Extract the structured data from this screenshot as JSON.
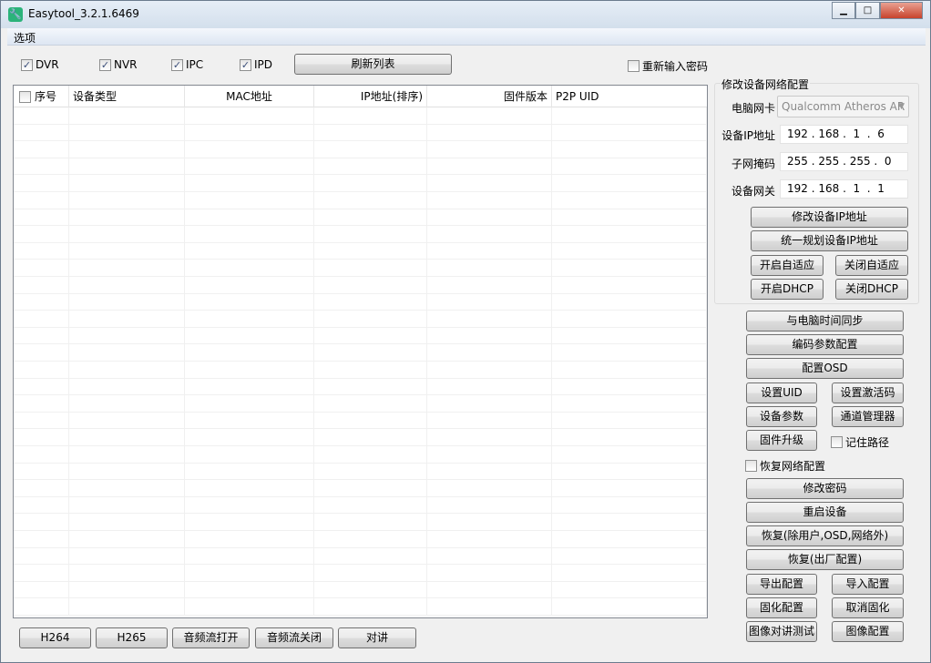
{
  "window": {
    "title": "Easytool_3.2.1.6469",
    "min": "▁",
    "max": "□",
    "close": "✕"
  },
  "menu": {
    "options": "选项"
  },
  "filters": [
    {
      "label": "DVR",
      "checked": true
    },
    {
      "label": "NVR",
      "checked": true
    },
    {
      "label": "IPC",
      "checked": true
    },
    {
      "label": "IPD",
      "checked": true
    }
  ],
  "refresh": "刷新列表",
  "reenter_password": {
    "label": "重新输入密码",
    "checked": false
  },
  "table": {
    "columns": [
      "序号",
      "设备类型",
      "MAC地址",
      "IP地址(排序)",
      "固件版本",
      "P2P UID"
    ],
    "rows": []
  },
  "network": {
    "group_title": "修改设备网络配置",
    "nic_label": "电脑网卡",
    "nic_value": "Qualcomm Atheros AR",
    "ip_label": "设备IP地址",
    "ip_value": "192 . 168 .  1  .  6",
    "mask_label": "子网掩码",
    "mask_value": "255 . 255 . 255 .  0",
    "gateway_label": "设备网关",
    "gateway_value": "192 . 168 .  1  .  1",
    "modify_ip": "修改设备IP地址",
    "plan_ip": "统一规划设备IP地址",
    "auto_on": "开启自适应",
    "auto_off": "关闭自适应",
    "dhcp_on": "开启DHCP",
    "dhcp_off": "关闭DHCP"
  },
  "actions": {
    "sync_time": "与电脑时间同步",
    "encode": "编码参数配置",
    "osd": "配置OSD",
    "set_uid": "设置UID",
    "activation": "设置激活码",
    "params": "设备参数",
    "channel": "通道管理器",
    "upgrade": "固件升级",
    "remember_path": "记住路径",
    "restore_network": "恢复网络配置",
    "password": "修改密码",
    "reboot": "重启设备",
    "restore_partial": "恢复(除用户,OSD,网络外)",
    "restore_factory": "恢复(出厂配置)",
    "export": "导出配置",
    "import": "导入配置",
    "solidify": "固化配置",
    "unsolidify": "取消固化",
    "intercom_test": "图像对讲测试",
    "image_config": "图像配置"
  },
  "bottom": {
    "h264": "H264",
    "h265": "H265",
    "audio_open": "音频流打开",
    "audio_close": "音频流关闭",
    "talk": "对讲"
  }
}
